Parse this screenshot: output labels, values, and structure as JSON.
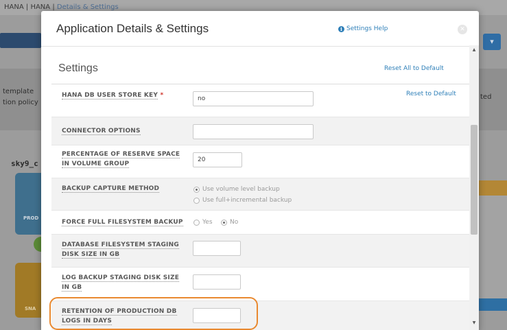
{
  "background": {
    "breadcrumb": [
      "HANA",
      "HANA",
      "Details & Settings"
    ],
    "text_line1": "template",
    "text_line2": "tion policy",
    "right_text": "ted",
    "host_label": "sky9_c",
    "card1_label": "PROD",
    "card2_label": "SNA",
    "dropdown_icon": "chevron-down-icon"
  },
  "modal": {
    "title": "Application Details & Settings",
    "help_label": "Settings Help",
    "help_icon": "info-icon",
    "close_icon": "close-icon"
  },
  "settings": {
    "section_title": "Settings",
    "reset_all_label": "Reset All to Default",
    "reset_one_label": "Reset to Default",
    "rows": [
      {
        "label": "HANA DB USER STORE KEY",
        "required_mark": "*",
        "value": "no"
      },
      {
        "label": "CONNECTOR OPTIONS",
        "value": ""
      },
      {
        "label": "PERCENTAGE OF RESERVE SPACE IN VOLUME GROUP",
        "value": "20"
      },
      {
        "label": "BACKUP CAPTURE METHOD",
        "options": [
          "Use volume level backup",
          "Use full+incremental backup"
        ],
        "selected": "Use volume level backup"
      },
      {
        "label": "FORCE FULL FILESYSTEM BACKUP",
        "options": [
          "Yes",
          "No"
        ],
        "selected": "No"
      },
      {
        "label": "DATABASE FILESYSTEM STAGING DISK SIZE IN GB",
        "value": ""
      },
      {
        "label": "LOG BACKUP STAGING DISK SIZE IN GB",
        "value": ""
      },
      {
        "label": "RETENTION OF PRODUCTION DB LOGS IN DAYS",
        "value": ""
      }
    ]
  },
  "colors": {
    "accent": "#2e7fb8",
    "highlight": "#e9892f",
    "required": "#d0342c"
  }
}
